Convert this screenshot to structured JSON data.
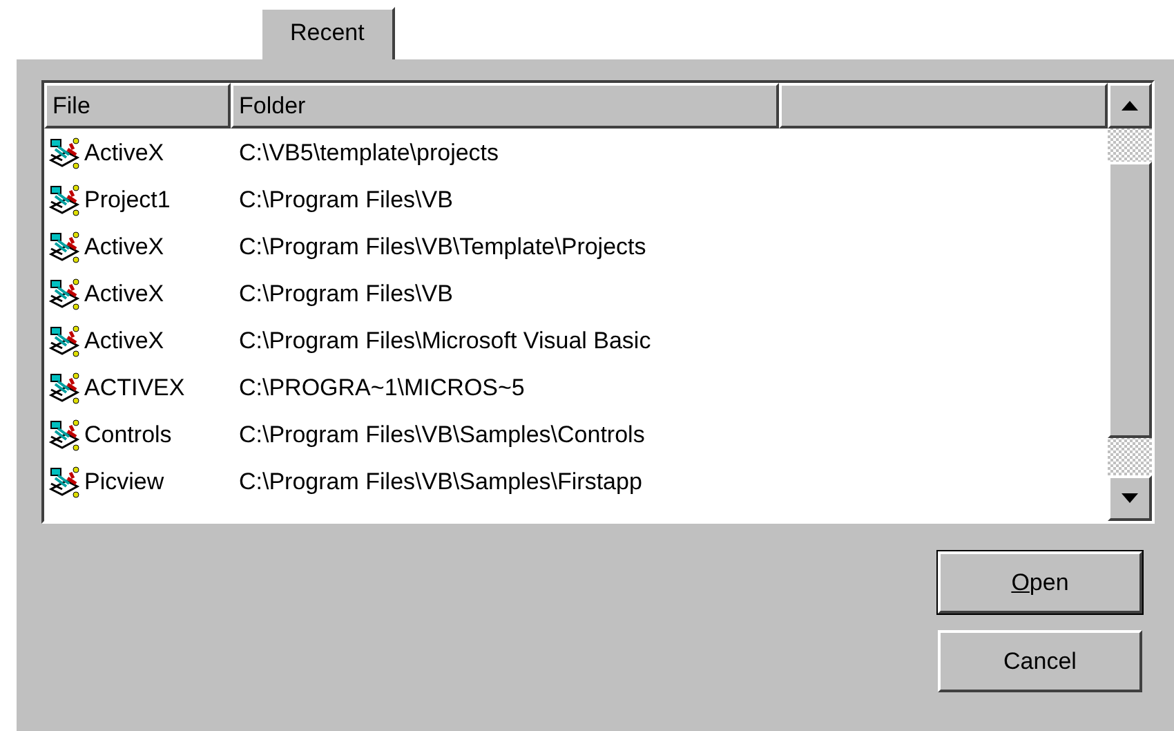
{
  "tabs": [
    {
      "label": "Recent",
      "selected": true
    }
  ],
  "table": {
    "columns": [
      "File",
      "Folder"
    ],
    "rows": [
      {
        "file": "ActiveX",
        "folder": "C:\\VB5\\template\\projects"
      },
      {
        "file": "Project1",
        "folder": "C:\\Program Files\\VB"
      },
      {
        "file": "ActiveX",
        "folder": "C:\\Program Files\\VB\\Template\\Projects"
      },
      {
        "file": "ActiveX",
        "folder": "C:\\Program Files\\VB"
      },
      {
        "file": "ActiveX",
        "folder": "C:\\Program Files\\Microsoft Visual Basic"
      },
      {
        "file": "ACTIVEX",
        "folder": "C:\\PROGRA~1\\MICROS~5"
      },
      {
        "file": "Controls",
        "folder": "C:\\Program Files\\VB\\Samples\\Controls"
      },
      {
        "file": "Picview",
        "folder": "C:\\Program Files\\VB\\Samples\\Firstapp"
      }
    ]
  },
  "buttons": [
    {
      "label": "Open",
      "first_letter_underlined": true
    },
    {
      "label": "Cancel",
      "first_letter_underlined": false
    }
  ]
}
